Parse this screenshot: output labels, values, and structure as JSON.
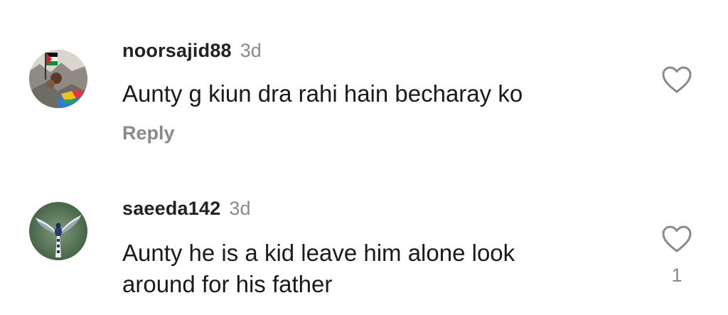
{
  "comments": [
    {
      "username": "noorsajid88",
      "time": "3d",
      "text": "Aunty g kiun dra rahi hain becharay ko",
      "reply_label": "Reply",
      "like_count": "",
      "avatar_icon": "flag-rubble-photo"
    },
    {
      "username": "saeeda142",
      "time": "3d",
      "text": "Aunty he is a kid leave him alone look around for his father",
      "reply_label": "",
      "like_count": "1",
      "avatar_icon": "bird-photo"
    }
  ],
  "colors": {
    "username": "#222222",
    "secondary": "#8a8a8a",
    "text": "#1a1a1a",
    "background": "#ffffff"
  }
}
